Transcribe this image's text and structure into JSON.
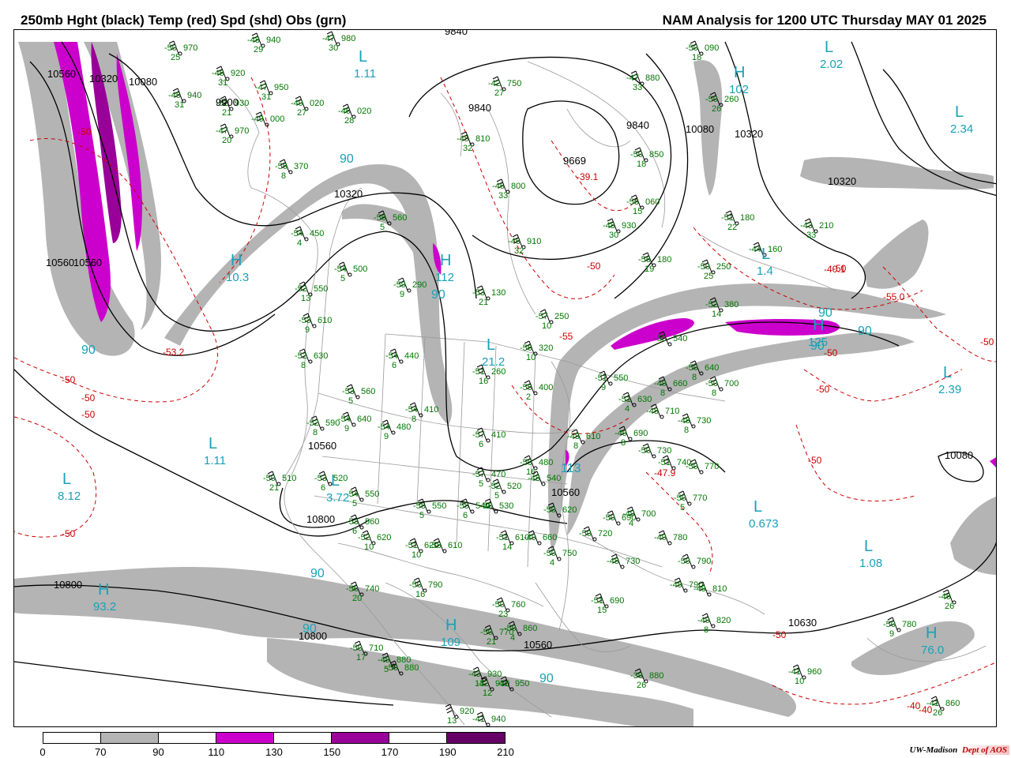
{
  "header": {
    "title_left": "250mb Hght (black) Temp (red) Spd (shd) Obs (grn)",
    "title_right": "NAM Analysis for 1200 UTC Thursday  MAY 01 2025"
  },
  "colors": {
    "height_contour": "#000000",
    "temp_contour": "#cc0000",
    "obs": "#007700",
    "centers": "#1aa0b8",
    "speed_70_90": "#b4b4b4",
    "speed_110_130": "#cc00cc",
    "speed_130_150": "#990099"
  },
  "colorbar": {
    "labels": [
      "0",
      "70",
      "90",
      "110",
      "130",
      "150",
      "170",
      "190",
      "210"
    ],
    "fills": [
      "#ffffff",
      "#b4b4b4",
      "#ffffff",
      "#cc00cc",
      "#ffffff",
      "#990099",
      "#ffffff",
      "#660066"
    ]
  },
  "credit": {
    "institution": "UW-Madison",
    "department": "Dept of AOS"
  },
  "height_labels": [
    "10560",
    "10320",
    "10080",
    "9900",
    "9840",
    "9840",
    "9669",
    "9840",
    "10080",
    "10320",
    "10320",
    "10320",
    "10560",
    "10560",
    "10560",
    "10800",
    "10800",
    "10800",
    "10630",
    "10080",
    "10560",
    "10560"
  ],
  "temp_labels": [
    "-50",
    "-53.2",
    "-50",
    "-50",
    "-50",
    "-39.1",
    "-50",
    "-55",
    "-50",
    "-55.0",
    "-40.1",
    "-50",
    "-50",
    "-50",
    "-50",
    "-47.9",
    "-40",
    "-50",
    "-50",
    "-40"
  ],
  "centers": [
    {
      "type": "H",
      "value": "93.2"
    },
    {
      "type": "H",
      "value": "109"
    },
    {
      "type": "H",
      "value": "76.0"
    },
    {
      "type": "L",
      "value": "8.12"
    },
    {
      "type": "L",
      "value": "1.11"
    },
    {
      "type": "L",
      "value": "3.72"
    },
    {
      "type": "H",
      "value": "10.3"
    },
    {
      "type": "H",
      "value": "112"
    },
    {
      "type": "L",
      "value": "21.2"
    },
    {
      "type": "L",
      "value": "0.673"
    },
    {
      "type": "L",
      "value": "1.08"
    },
    {
      "type": "L",
      "value": "2.39"
    },
    {
      "type": "L",
      "value": "2.02"
    },
    {
      "type": "L",
      "value": "2.34"
    },
    {
      "type": "L",
      "value": "1.11"
    },
    {
      "type": "H",
      "value": "102"
    },
    {
      "type": "H",
      "value": "125"
    },
    {
      "type": "L",
      "value": "1.4"
    }
  ],
  "speed_labels": [
    "90",
    "90",
    "90",
    "90",
    "90",
    "90",
    "90",
    "90",
    "90",
    "113"
  ],
  "observations": [
    {
      "temp": "-50",
      "hgt": "970",
      "dew": "25"
    },
    {
      "temp": "-48",
      "hgt": "940",
      "dew": "29"
    },
    {
      "temp": "-47",
      "hgt": "980",
      "dew": "30"
    },
    {
      "temp": "-46",
      "hgt": "920",
      "dew": "31"
    },
    {
      "temp": "-47",
      "hgt": "950",
      "dew": "31"
    },
    {
      "temp": "-45",
      "hgt": "940",
      "dew": "31"
    },
    {
      "temp": "-52",
      "hgt": "930",
      "dew": "21"
    },
    {
      "temp": "-47",
      "hgt": "970",
      "dew": "20"
    },
    {
      "temp": "-49",
      "hgt": "000",
      "dew": ""
    },
    {
      "temp": "-49",
      "hgt": "020",
      "dew": "27"
    },
    {
      "temp": "-46",
      "hgt": "020",
      "dew": "28"
    },
    {
      "temp": "-42",
      "hgt": "750",
      "dew": "27"
    },
    {
      "temp": "-45",
      "hgt": "810",
      "dew": "32"
    },
    {
      "temp": "-46",
      "hgt": "800",
      "dew": "33"
    },
    {
      "temp": "-47",
      "hgt": "880",
      "dew": "33"
    },
    {
      "temp": "-50",
      "hgt": "850",
      "dew": "18"
    },
    {
      "temp": "-50",
      "hgt": "090",
      "dew": "18"
    },
    {
      "temp": "-50",
      "hgt": "260",
      "dew": "26"
    },
    {
      "temp": "-56",
      "hgt": "370",
      "dew": "8"
    },
    {
      "temp": "-54",
      "hgt": "450",
      "dew": "4"
    },
    {
      "temp": "-56",
      "hgt": "560",
      "dew": "5"
    },
    {
      "temp": "-54",
      "hgt": "500",
      "dew": "5"
    },
    {
      "temp": "-59",
      "hgt": "290",
      "dew": "9"
    },
    {
      "temp": "-52",
      "hgt": "550",
      "dew": "13"
    },
    {
      "temp": "-53",
      "hgt": "610",
      "dew": "9"
    },
    {
      "temp": "-52",
      "hgt": "630",
      "dew": "8"
    },
    {
      "temp": "-54",
      "hgt": "440",
      "dew": "6"
    },
    {
      "temp": "-53",
      "hgt": "560",
      "dew": "5"
    },
    {
      "temp": "-54",
      "hgt": "410",
      "dew": "8"
    },
    {
      "temp": "-52",
      "hgt": "590",
      "dew": "8"
    },
    {
      "temp": "-54",
      "hgt": "640",
      "dew": "9"
    },
    {
      "temp": "-54",
      "hgt": "480",
      "dew": "9"
    },
    {
      "temp": "-53",
      "hgt": "130",
      "dew": "21"
    },
    {
      "temp": "-46",
      "hgt": "910",
      "dew": "32"
    },
    {
      "temp": "-48",
      "hgt": "930",
      "dew": "30"
    },
    {
      "temp": "-56",
      "hgt": "060",
      "dew": "15"
    },
    {
      "temp": "-57",
      "hgt": "250",
      "dew": "10"
    },
    {
      "temp": "-56",
      "hgt": "320",
      "dew": "10"
    },
    {
      "temp": "-51",
      "hgt": "260",
      "dew": "16"
    },
    {
      "temp": "-55",
      "hgt": "400",
      "dew": "2"
    },
    {
      "temp": "-57",
      "hgt": "410",
      "dew": "6"
    },
    {
      "temp": "-56",
      "hgt": "180",
      "dew": "19"
    },
    {
      "temp": "-50",
      "hgt": "250",
      "dew": "25"
    },
    {
      "temp": "-51",
      "hgt": "180",
      "dew": "22"
    },
    {
      "temp": "-44",
      "hgt": "160",
      "dew": ""
    },
    {
      "temp": "-43",
      "hgt": "210",
      "dew": "33"
    },
    {
      "temp": "-52",
      "hgt": "380",
      "dew": "14"
    },
    {
      "temp": "-55",
      "hgt": "540",
      "dew": ""
    },
    {
      "temp": "-51",
      "hgt": "550",
      "dew": "9"
    },
    {
      "temp": "-51",
      "hgt": "630",
      "dew": "4"
    },
    {
      "temp": "-49",
      "hgt": "660",
      "dew": "8"
    },
    {
      "temp": "-50",
      "hgt": "640",
      "dew": "8"
    },
    {
      "temp": "-50",
      "hgt": "700",
      "dew": "8"
    },
    {
      "temp": "-48",
      "hgt": "710",
      "dew": ""
    },
    {
      "temp": "-48",
      "hgt": "730",
      "dew": "8"
    },
    {
      "temp": "-49",
      "hgt": "690",
      "dew": "8"
    },
    {
      "temp": "-48",
      "hgt": "610",
      "dew": "8"
    },
    {
      "temp": "-50",
      "hgt": "730",
      "dew": ""
    },
    {
      "temp": "-51",
      "hgt": "740",
      "dew": ""
    },
    {
      "temp": "-50",
      "hgt": "770",
      "dew": ""
    },
    {
      "temp": "-50",
      "hgt": "770",
      "dew": "5"
    },
    {
      "temp": "-49",
      "hgt": "780",
      "dew": ""
    },
    {
      "temp": "-50",
      "hgt": "790",
      "dew": ""
    },
    {
      "temp": "-49",
      "hgt": "790",
      "dew": ""
    },
    {
      "temp": "-49",
      "hgt": "810",
      "dew": ""
    },
    {
      "temp": "-49",
      "hgt": "820",
      "dew": "8"
    },
    {
      "temp": "-50",
      "hgt": "510",
      "dew": "21"
    },
    {
      "temp": "-53",
      "hgt": "520",
      "dew": "6"
    },
    {
      "temp": "-54",
      "hgt": "550",
      "dew": "5"
    },
    {
      "temp": "-53",
      "hgt": "560",
      "dew": "6"
    },
    {
      "temp": "-55",
      "hgt": "550",
      "dew": "5"
    },
    {
      "temp": "-55",
      "hgt": "540",
      "dew": "6"
    },
    {
      "temp": "-57",
      "hgt": "470",
      "dew": "5"
    },
    {
      "temp": "-52",
      "hgt": "520",
      "dew": "5"
    },
    {
      "temp": "-50",
      "hgt": "530",
      "dew": ""
    },
    {
      "temp": "-50",
      "hgt": "480",
      "dew": "16"
    },
    {
      "temp": "-48",
      "hgt": "540",
      "dew": ""
    },
    {
      "temp": "-52",
      "hgt": "620",
      "dew": "10"
    },
    {
      "temp": "-51",
      "hgt": "620",
      "dew": "10"
    },
    {
      "temp": "-53",
      "hgt": "610",
      "dew": ""
    },
    {
      "temp": "-51",
      "hgt": "610",
      "dew": "14"
    },
    {
      "temp": "-49",
      "hgt": "660",
      "dew": ""
    },
    {
      "temp": "-50",
      "hgt": "620",
      "dew": ""
    },
    {
      "temp": "-50",
      "hgt": "720",
      "dew": ""
    },
    {
      "temp": "-48",
      "hgt": "730",
      "dew": ""
    },
    {
      "temp": "-50",
      "hgt": "690",
      "dew": ""
    },
    {
      "temp": "-49",
      "hgt": "700",
      "dew": "4"
    },
    {
      "temp": "-50",
      "hgt": "750",
      "dew": "4"
    },
    {
      "temp": "-51",
      "hgt": "690",
      "dew": "15"
    },
    {
      "temp": "-50",
      "hgt": "790",
      "dew": "16"
    },
    {
      "temp": "-50",
      "hgt": "740",
      "dew": "20"
    },
    {
      "temp": "-50",
      "hgt": "710",
      "dew": "17"
    },
    {
      "temp": "-50",
      "hgt": "760",
      "dew": "23"
    },
    {
      "temp": "-50",
      "hgt": "770",
      "dew": "21"
    },
    {
      "temp": "-50",
      "hgt": "860",
      "dew": "4"
    },
    {
      "temp": "-49",
      "hgt": "880",
      "dew": "5"
    },
    {
      "temp": "-50",
      "hgt": "880",
      "dew": ""
    },
    {
      "temp": "-43",
      "hgt": "930",
      "dew": "13"
    },
    {
      "temp": "-42",
      "hgt": "930",
      "dew": "12"
    },
    {
      "temp": "-41",
      "hgt": "950",
      "dew": ""
    },
    {
      "temp": "-41",
      "hgt": "940",
      "dew": ""
    },
    {
      "temp": "",
      "hgt": "920",
      "dew": "13"
    },
    {
      "temp": "-39",
      "hgt": "880",
      "dew": "26"
    },
    {
      "temp": "-41",
      "hgt": "960",
      "dew": "10"
    },
    {
      "temp": "-41",
      "hgt": "860",
      "dew": "26"
    },
    {
      "temp": "-46",
      "hgt": "",
      "dew": "26"
    },
    {
      "temp": "-50",
      "hgt": "780",
      "dew": "9"
    }
  ]
}
